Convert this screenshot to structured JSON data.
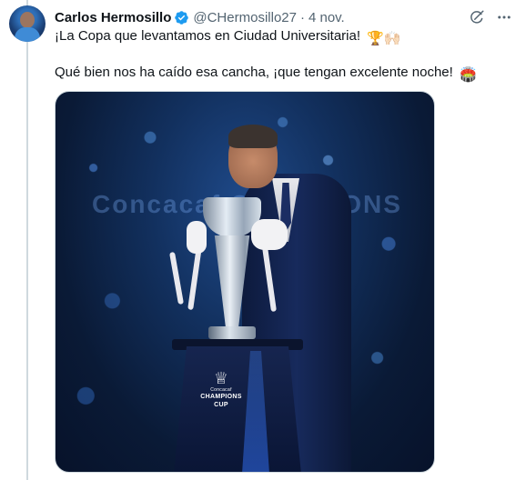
{
  "tweet": {
    "author_name": "Carlos Hermosillo",
    "handle": "@CHermosillo27",
    "separator": "·",
    "date": "4 nov.",
    "text_line1": "¡La Copa que levantamos en Ciudad Universitaria!",
    "emoji_line1": "🏆🙌🏻",
    "text_line2": "Qué bien nos ha caído esa cancha, ¡que tengan excelente noche!",
    "emoji_line2": "🏟️"
  },
  "photo": {
    "logo_small": "Concacaf",
    "logo_big_1": "CHAMPIONS",
    "logo_big_2": "CUP",
    "banner_text": "Concacaf  CHAMPIONS"
  },
  "colors": {
    "verified_blue": "#1d9bf0",
    "secondary_text": "#536471",
    "primary_text": "#0f1419"
  },
  "icons": [
    "grok-icon",
    "more-icon",
    "verified-icon"
  ]
}
